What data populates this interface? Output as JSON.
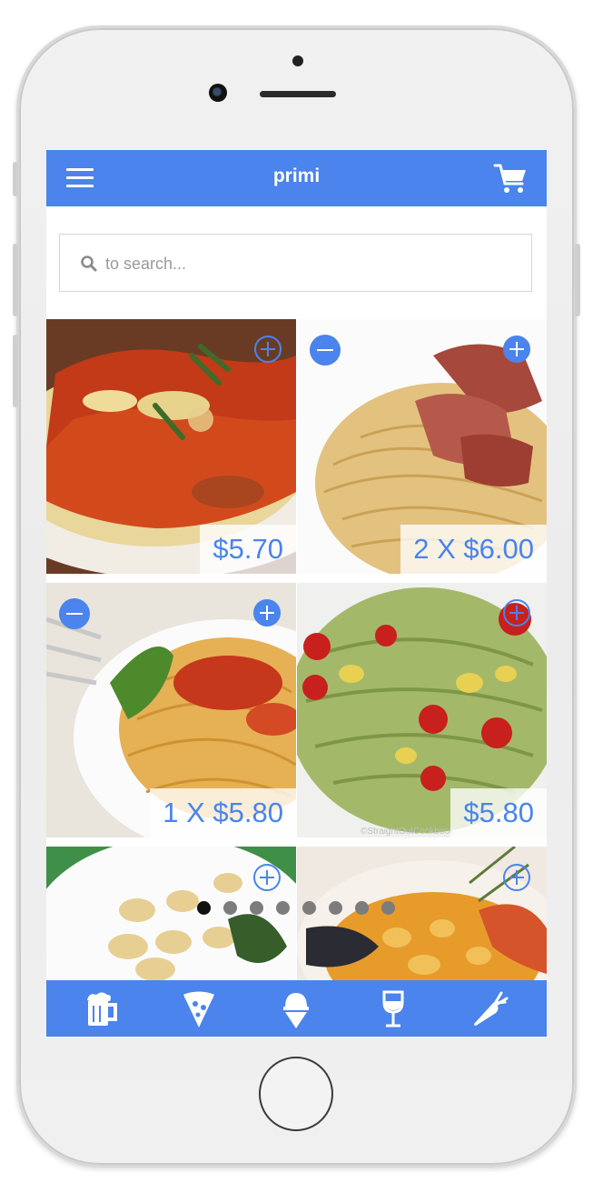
{
  "header": {
    "title": "primi"
  },
  "search": {
    "placeholder": "to search..."
  },
  "items": [
    {
      "price_label": "$5.70",
      "has_minus": false
    },
    {
      "price_label": "2 X $6.00",
      "has_minus": true
    },
    {
      "price_label": "1 X $5.80",
      "has_minus": true
    },
    {
      "price_label": "$5.80",
      "has_minus": false
    },
    {
      "price_label": "",
      "has_minus": false
    },
    {
      "price_label": "",
      "has_minus": false
    }
  ],
  "pager": {
    "count": 8,
    "active": 0
  },
  "tabs": [
    "beer-icon",
    "pizza-icon",
    "ice-cream-icon",
    "wine-icon",
    "carrot-icon"
  ],
  "colors": {
    "accent": "#4a84ec"
  }
}
